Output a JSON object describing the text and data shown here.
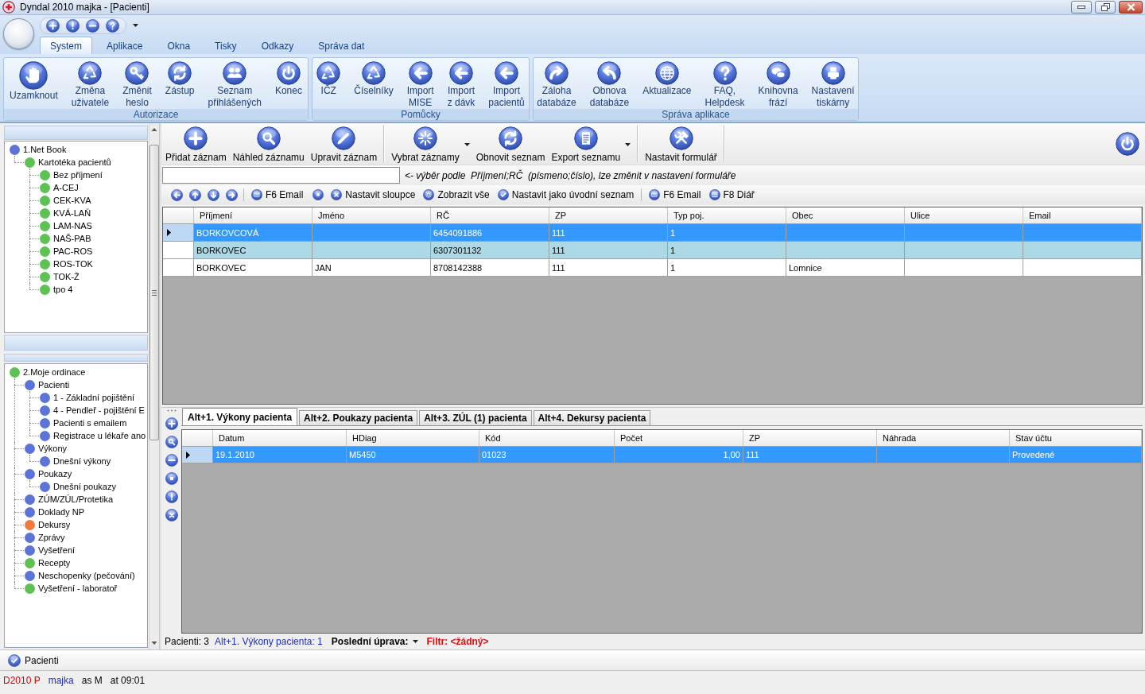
{
  "window": {
    "title": "Dyndal 2010 majka - [Pacienti]"
  },
  "ribbon": {
    "tabs": [
      {
        "label": "System",
        "selected": true
      },
      {
        "label": "Aplikace",
        "selected": false
      },
      {
        "label": "Okna",
        "selected": false
      },
      {
        "label": "Tisky",
        "selected": false
      },
      {
        "label": "Odkazy",
        "selected": false
      },
      {
        "label": "Správa dat",
        "selected": false
      }
    ],
    "groups": [
      {
        "label": "Autorizace",
        "buttons": [
          "Uzamknout",
          "Změna\nuživatele",
          "Změnit\nheslo",
          "Zástup",
          "Seznam\npřihlášených",
          "Konec"
        ]
      },
      {
        "label": "Pomůcky",
        "buttons": [
          "IČZ",
          "Číselníky",
          "Import\nMISE",
          "Import\nz dávk",
          "Import\npacientů"
        ]
      },
      {
        "label": "Správa aplikace",
        "buttons": [
          "Záloha\ndatabáze",
          "Obnova\ndatabáze",
          "Aktualizace",
          "FAQ,\nHelpdesk",
          "Knihovna\nfrází",
          "Nastavení\ntiskárny"
        ]
      }
    ]
  },
  "navigation_pane": {
    "trees": [
      {
        "nodes": [
          {
            "label": "1.Net Book",
            "color": "#5b74d6",
            "children": [
              {
                "label": "Kartotéka pacientů",
                "color": "#5dc153",
                "children": [
                  {
                    "label": "Bez příjmení",
                    "color": "#5dc153"
                  },
                  {
                    "label": "A-CEJ",
                    "color": "#5dc153"
                  },
                  {
                    "label": "CEK-KVA",
                    "color": "#5dc153"
                  },
                  {
                    "label": "KVÁ-LAŇ",
                    "color": "#5dc153"
                  },
                  {
                    "label": "LAM-NAS",
                    "color": "#5dc153"
                  },
                  {
                    "label": "NAŠ-PAB",
                    "color": "#5dc153"
                  },
                  {
                    "label": "PAC-ROS",
                    "color": "#5dc153"
                  },
                  {
                    "label": "ROS-TOK",
                    "color": "#5dc153"
                  },
                  {
                    "label": "TOK-Ž",
                    "color": "#5dc153"
                  },
                  {
                    "label": "tpo 4",
                    "color": "#5dc153"
                  }
                ]
              }
            ]
          }
        ]
      },
      {
        "nodes": [
          {
            "label": "2.Moje ordinace",
            "color": "#5dc153",
            "children": [
              {
                "label": "Pacienti",
                "color": "#5b74d6",
                "children": [
                  {
                    "label": "1 - Základní pojištění",
                    "color": "#5b74d6"
                  },
                  {
                    "label": "4 - Pendleř - pojištění E",
                    "color": "#5b74d6"
                  },
                  {
                    "label": "Pacienti s emailem",
                    "color": "#5b74d6"
                  },
                  {
                    "label": "Registrace u lékaře ano",
                    "color": "#5b74d6"
                  }
                ]
              },
              {
                "label": "Výkony",
                "color": "#5b74d6",
                "children": [
                  {
                    "label": "Dnešní výkony",
                    "color": "#5b74d6"
                  }
                ]
              },
              {
                "label": "Poukazy",
                "color": "#5b74d6",
                "children": [
                  {
                    "label": "Dnešní poukazy",
                    "color": "#5b74d6"
                  }
                ]
              },
              {
                "label": "ZÚM/ZÚL/Protetika",
                "color": "#5b74d6"
              },
              {
                "label": "Doklady NP",
                "color": "#5b74d6"
              },
              {
                "label": "Dekursy",
                "color": "#f07b3c"
              },
              {
                "label": "Zprávy",
                "color": "#5b74d6"
              },
              {
                "label": "Vyšetření",
                "color": "#5b74d6"
              },
              {
                "label": "Recepty",
                "color": "#5dc153"
              },
              {
                "label": "Neschopenky (pečování)",
                "color": "#5b74d6"
              },
              {
                "label": "Vyšetření - laboratoř",
                "color": "#5dc153"
              }
            ]
          }
        ]
      }
    ],
    "pane_button": "Pacienti"
  },
  "toolbar": {
    "buttons": [
      {
        "label": "Přidat záznam",
        "dropdown": false
      },
      {
        "label": "Náhled záznamu",
        "dropdown": false
      },
      {
        "label": "Upravit záznam",
        "dropdown": false
      },
      {
        "label": "Vybrat záznamy",
        "dropdown": true
      },
      {
        "label": "Obnovit seznam",
        "dropdown": false
      },
      {
        "label": "Export seznamu",
        "dropdown": true
      },
      {
        "label": "Nastavit formulář",
        "dropdown": false
      }
    ]
  },
  "filter": {
    "hint_text": "<- výběr podle  Příjmení;RČ  (písmeno;číslo), lze změnit v nastavení formuláře"
  },
  "list_toolbar": {
    "buttons": [
      "F6 Email",
      "Nastavit sloupce",
      "Zobrazit vše",
      "Nastavit jako úvodní seznam",
      "F6 Email",
      "F8 Diář"
    ]
  },
  "patients_table": {
    "columns": [
      "Příjmení",
      "Jméno",
      "RČ",
      "ZP",
      "Typ poj.",
      "Obec",
      "Ulice",
      "Email"
    ],
    "rows": [
      {
        "cells": [
          "BORKOVCOVÁ",
          null,
          "6454091886",
          "111",
          "1",
          null,
          null,
          null
        ],
        "selected": true,
        "highlighted": false
      },
      {
        "cells": [
          "BORKOVEC",
          null,
          "6307301132",
          "111",
          "1",
          null,
          null,
          null
        ],
        "selected": false,
        "highlighted": true
      },
      {
        "cells": [
          "BORKOVEC",
          "JAN",
          "8708142388",
          "111",
          "1",
          "Lomnice",
          null,
          null
        ],
        "selected": false,
        "highlighted": false
      }
    ]
  },
  "detail_tabs": [
    {
      "label": "Alt+1. Výkony pacienta",
      "selected": true
    },
    {
      "label": "Alt+2. Poukazy pacienta",
      "selected": false
    },
    {
      "label": "Alt+3. ZÚL (1) pacienta",
      "selected": false
    },
    {
      "label": "Alt+4. Dekursy pacienta",
      "selected": false
    }
  ],
  "detail_table": {
    "columns": [
      "Datum",
      "HDiag",
      "Kód",
      "Počet",
      "ZP",
      "Náhrada",
      "Stav účtu"
    ],
    "rows": [
      {
        "cells": [
          "19.1.2010",
          "M5450",
          "01023",
          "1,00",
          "111",
          null,
          "Provedené"
        ],
        "selected": true
      }
    ]
  },
  "summary_line": [
    {
      "text": "Pacienti: 3",
      "kind": "plain"
    },
    {
      "text": "Alt+1. Výkony pacienta: 1",
      "kind": "link"
    },
    {
      "text": "Poslední úprava:",
      "kind": "dropdown"
    },
    {
      "text": "Filtr: <žádný>",
      "kind": "alert"
    }
  ],
  "status_bar": [
    {
      "text": "D2010 P",
      "kind": "alert"
    },
    {
      "text": "majka",
      "kind": "link"
    },
    {
      "text": "as M",
      "kind": "plain"
    },
    {
      "text": "at 09:01",
      "kind": "plain"
    }
  ]
}
